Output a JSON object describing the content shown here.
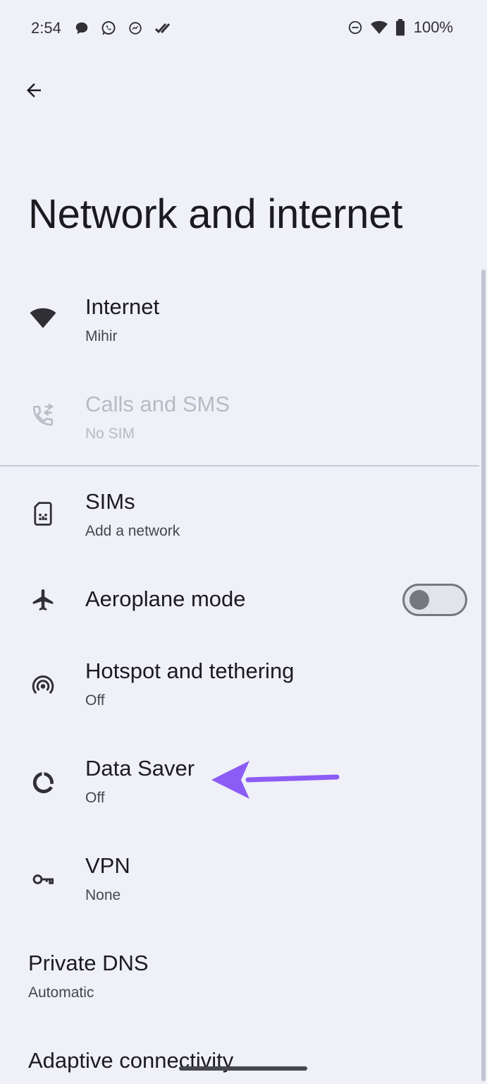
{
  "status_bar": {
    "time": "2:54",
    "notification_icons": [
      "chat-bubble-icon",
      "whatsapp-icon",
      "messenger-icon",
      "double-check-icon"
    ],
    "system_icons": [
      "do-not-disturb-icon",
      "wifi-icon",
      "battery-icon"
    ],
    "battery": "100%"
  },
  "header": {
    "back_icon": "arrow-back-icon",
    "title": "Network and internet"
  },
  "items": [
    {
      "id": "internet",
      "icon": "wifi-icon",
      "title": "Internet",
      "subtitle": "Mihir",
      "enabled": true
    },
    {
      "id": "calls",
      "icon": "phone-forward-icon",
      "title": "Calls and SMS",
      "subtitle": "No SIM",
      "enabled": false
    },
    {
      "id": "sims",
      "icon": "sim-card-icon",
      "title": "SIMs",
      "subtitle": "Add a network",
      "enabled": true
    },
    {
      "id": "aeroplane",
      "icon": "airplane-icon",
      "title": "Aeroplane mode",
      "toggle_on": false,
      "enabled": true
    },
    {
      "id": "hotspot",
      "icon": "hotspot-icon",
      "title": "Hotspot and tethering",
      "subtitle": "Off",
      "enabled": true
    },
    {
      "id": "datasaver",
      "icon": "data-saver-icon",
      "title": "Data Saver",
      "subtitle": "Off",
      "enabled": true
    },
    {
      "id": "vpn",
      "icon": "key-icon",
      "title": "VPN",
      "subtitle": "None",
      "enabled": true
    },
    {
      "id": "dns",
      "title": "Private DNS",
      "subtitle": "Automatic",
      "enabled": true
    },
    {
      "id": "adaptive",
      "title": "Adaptive connectivity",
      "enabled": true
    }
  ],
  "colors": {
    "background": "#eff0f8",
    "text_primary": "#1b1b1f",
    "text_secondary": "#46464f",
    "disabled": "#b9bac3",
    "annotation_arrow": "#8b5cf6"
  }
}
